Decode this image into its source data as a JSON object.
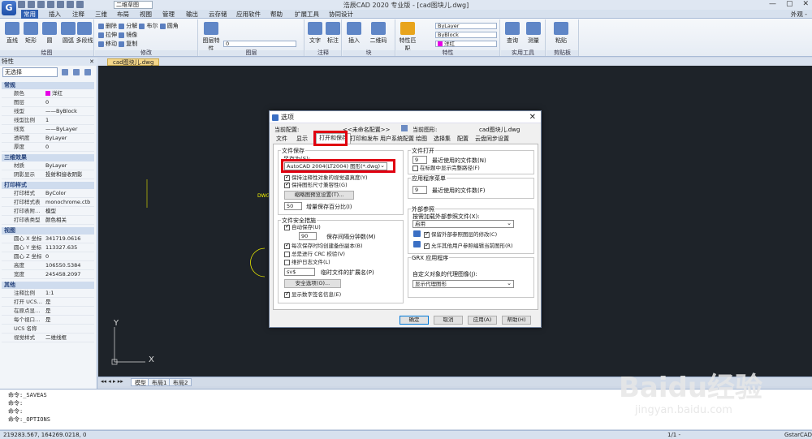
{
  "app": {
    "title": "浩辰CAD 2020 专业版 - [cad图块儿.dwg]",
    "logo": "G",
    "view_select": "二维草图",
    "appearance": "外观 -"
  },
  "ribbon_tabs": [
    "常用",
    "插入",
    "注释",
    "三维",
    "布局",
    "视图",
    "管理",
    "输出",
    "云存储",
    "应用软件",
    "帮助",
    "扩展工具",
    "协同设计"
  ],
  "ribbon": {
    "draw": {
      "label": "绘图",
      "line": "直线",
      "rect": "矩形",
      "circle": "圆",
      "arc": "圆弧",
      "poly": "多段线"
    },
    "modify": {
      "label": "修改",
      "items": [
        "删除",
        "分解",
        "布尔",
        "圆角",
        "拉伸",
        "镜像",
        "移动",
        "复制",
        "缩放",
        "旋转",
        "阵列",
        "倒角"
      ]
    },
    "layer": {
      "label": "图层",
      "props": "图层特性",
      "current": "0"
    },
    "anno": {
      "label": "注释",
      "text": "文字",
      "dim": "标注"
    },
    "block": {
      "label": "块",
      "insert": "插入",
      "qr": "二维码"
    },
    "props": {
      "label": "特性",
      "match": "特性匹配",
      "bylayer1": "ByLayer",
      "byblock": "ByBlock",
      "bylayer2": "ByLayer",
      "color": "洋红"
    },
    "tools": {
      "label": "实用工具",
      "query": "查询",
      "measure": "测量"
    },
    "clip": {
      "label": "剪贴板",
      "paste": "粘贴"
    }
  },
  "doc_tab": "cad图块儿.dwg",
  "properties": {
    "title": "特性",
    "select": "无选择",
    "sections": [
      {
        "name": "常规",
        "rows": [
          [
            "颜色",
            "洋红"
          ],
          [
            "图层",
            "0"
          ],
          [
            "线型",
            "——ByBlock"
          ],
          [
            "线型比例",
            "1"
          ],
          [
            "线宽",
            "——ByLayer"
          ],
          [
            "透明度",
            "ByLayer"
          ],
          [
            "厚度",
            "0"
          ]
        ]
      },
      {
        "name": "三维效果",
        "rows": [
          [
            "材质",
            "ByLayer"
          ],
          [
            "阴影显示",
            "投射和接收阴影"
          ]
        ]
      },
      {
        "name": "打印样式",
        "rows": [
          [
            "打印样式",
            "ByColor"
          ],
          [
            "打印样式表",
            "monochrome.ctb"
          ],
          [
            "打印表附…",
            "模型"
          ],
          [
            "打印表类型",
            "颜色相关"
          ]
        ]
      },
      {
        "name": "视图",
        "rows": [
          [
            "圆心 X 坐标",
            "341719.0616"
          ],
          [
            "圆心 Y 坐标",
            "113327.635"
          ],
          [
            "圆心 Z 坐标",
            "0"
          ],
          [
            "高度",
            "106550.5384"
          ],
          [
            "宽度",
            "245458.2097"
          ]
        ]
      },
      {
        "name": "其他",
        "rows": [
          [
            "注释比例",
            "1:1"
          ],
          [
            "打开 UCS…",
            "是"
          ],
          [
            "在原点显…",
            "是"
          ],
          [
            "每个视口…",
            "是"
          ],
          [
            "UCS 名称",
            ""
          ],
          [
            "视觉样式",
            "二维线框"
          ]
        ]
      }
    ]
  },
  "layout_tabs": [
    "模型",
    "布局1",
    "布局2"
  ],
  "command_lines": [
    "命令:_SAVEAS",
    "命令:",
    "命令:",
    "命令:_OPTIONS"
  ],
  "status_coords": "219283.567, 164269.0218, 0",
  "status_right": "GstarCAD",
  "status_scale": "1/1 -",
  "dialog": {
    "title": "选项",
    "current_config_label": "当前配置:",
    "current_config_value": "<<未命名配置>>",
    "current_drawing_label": "当前图形:",
    "current_drawing_value": "cad图块儿.dwg",
    "tabs": [
      "文件",
      "显示",
      "打开和保存",
      "打印和发布",
      "用户系统配置",
      "绘图",
      "选择集",
      "配置",
      "云盘同步设置"
    ],
    "active_tab": 2,
    "file_save": {
      "group": "文件保存",
      "save_as_label": "另存为(S):",
      "save_as_value": "AutoCAD 2004(LT2004) 图形(*.dwg)",
      "cb1": "保持注释性对象的视觉逼真度(Y)",
      "cb2": "保持图形尺寸兼容性(G)",
      "thumb_btn": "缩略图预览设置(T)...",
      "incr_value": "50",
      "incr_label": "增量保存百分比(I)"
    },
    "safety": {
      "group": "文件安全措施",
      "autosave": "自动保存(U)",
      "minutes_value": "90",
      "minutes_label": "保存间隔分钟数(M)",
      "backup": "每次保存时均创建备份副本(B)",
      "crc": "总是进行 CRC 校验(V)",
      "log": "维护日志文件(L)",
      "ext_value": "sv$",
      "ext_label": "临时文件的扩展名(P)",
      "security_btn": "安全选项(O)...",
      "signature": "显示数字签名信息(E)"
    },
    "file_open": {
      "group": "文件打开",
      "recent_value": "9",
      "recent_label": "最近使用的文件数(N)",
      "fullpath": "在标题中显示完整路径(F)"
    },
    "app_menu": {
      "group": "应用程序菜单",
      "recent_value": "9",
      "recent_label": "最近使用的文件数(F)"
    },
    "xref": {
      "group": "外部参照",
      "demand_label": "按需加载外部参照文件(X):",
      "demand_value": "启用",
      "keep_changes": "保留外部参照图层的修改(C)",
      "allow_edit": "允许其他用户参照编辑当前图形(R)"
    },
    "grx": {
      "group": "GRX 应用程序",
      "proxy_label": "自定义对象的代理图像(J):",
      "proxy_value": "显示代理图形"
    },
    "buttons": {
      "ok": "确定",
      "cancel": "取消",
      "apply": "应用(A)",
      "help": "帮助(H)"
    }
  },
  "watermark": {
    "brand": "Baidu经验",
    "url": "jingyan.baidu.com"
  },
  "canvas_axis": {
    "y": "Y",
    "x": "X"
  },
  "colors": {
    "accent": "#2f5fb1",
    "highlight": "#e00010",
    "canvas": "#1e2329",
    "magenta": "#e600e6"
  }
}
